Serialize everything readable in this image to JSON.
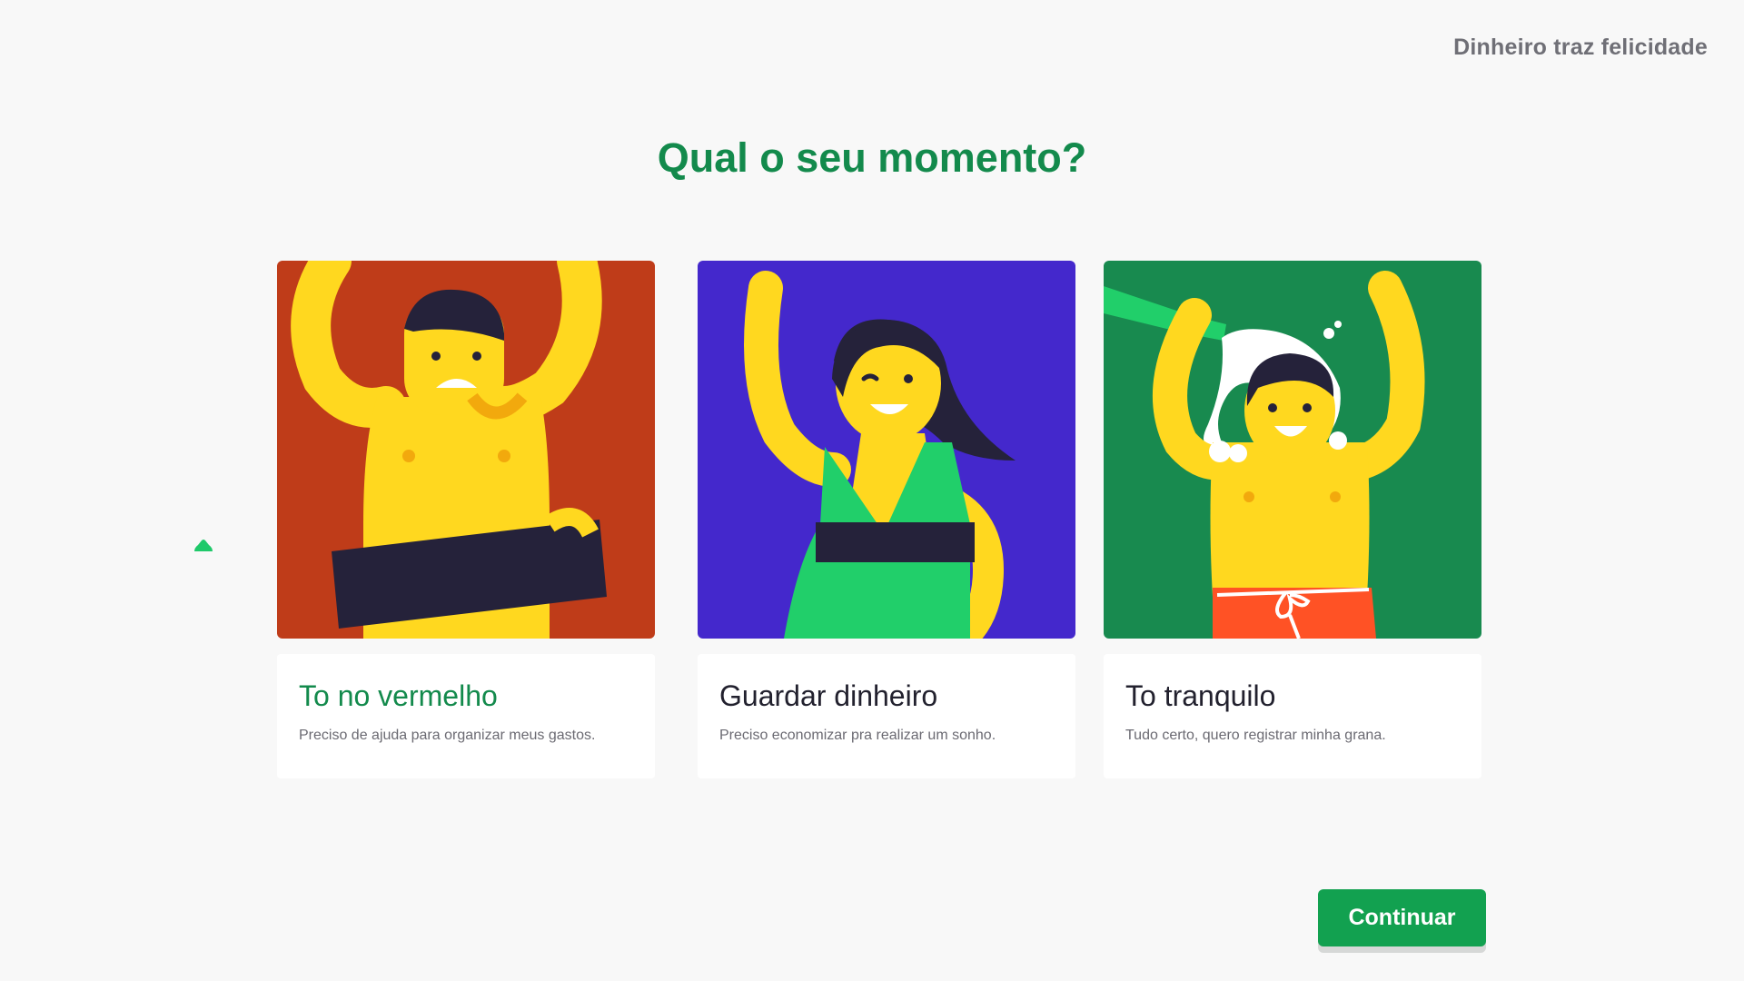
{
  "header": {
    "brand": "Dinheiro traz felicidade"
  },
  "page": {
    "title": "Qual o seu momento?"
  },
  "options": [
    {
      "name": "To no vermelho",
      "description": "Preciso de ajuda para organizar meus gastos.",
      "selected": true,
      "background": "#bf3c19"
    },
    {
      "name": "Guardar dinheiro",
      "description": "Preciso economizar pra realizar um sonho.",
      "selected": false,
      "background": "#4428cc"
    },
    {
      "name": "To tranquilo",
      "description": "Tudo certo, quero registrar minha grana.",
      "selected": false,
      "background": "#188a4f"
    }
  ],
  "selected_indicator_icon": "chevron-up-icon",
  "footer": {
    "continue_label": "Continuar"
  },
  "colors": {
    "accent": "#138a4c",
    "button": "#12a150",
    "selected_bg": "#e3f3ea",
    "character": "#ffd81f"
  }
}
